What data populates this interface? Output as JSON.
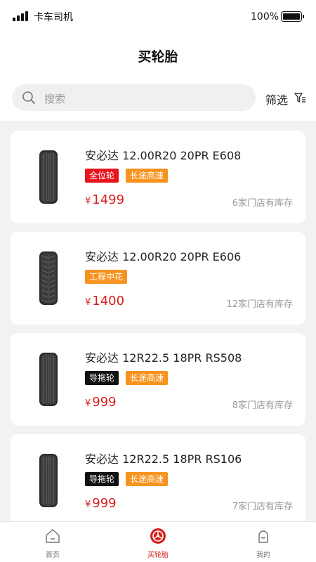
{
  "status_bar": {
    "carrier": "卡车司机",
    "battery_percent": "100%",
    "battery_level": 1.0
  },
  "header": {
    "title": "买轮胎"
  },
  "search": {
    "placeholder": "搜索",
    "icon": "search-icon"
  },
  "filter": {
    "label": "筛选",
    "icon": "filter-icon"
  },
  "products": [
    {
      "title": "安必达 12.00R20 20PR E608",
      "tags": [
        {
          "label": "全位轮",
          "color": "#e8141c"
        },
        {
          "label": "长途高速",
          "color": "#f7931e"
        }
      ],
      "currency": "¥",
      "price": "1499",
      "stock": "6家门店有库存",
      "tread": "rib"
    },
    {
      "title": "安必达 12.00R20 20PR E606",
      "tags": [
        {
          "label": "工程中花",
          "color": "#f7931e"
        }
      ],
      "currency": "¥",
      "price": "1400",
      "stock": "12家门店有库存",
      "tread": "block"
    },
    {
      "title": "安必达 12R22.5 18PR RS508",
      "tags": [
        {
          "label": "导拖轮",
          "color": "#111111"
        },
        {
          "label": "长途高速",
          "color": "#f7931e"
        }
      ],
      "currency": "¥",
      "price": "999",
      "stock": "8家门店有库存",
      "tread": "rib"
    },
    {
      "title": "安必达 12R22.5 18PR RS106",
      "tags": [
        {
          "label": "导拖轮",
          "color": "#111111"
        },
        {
          "label": "长途高速",
          "color": "#f7931e"
        }
      ],
      "currency": "¥",
      "price": "999",
      "stock": "7家门店有库存",
      "tread": "rib"
    }
  ],
  "tabbar": {
    "tabs": [
      {
        "label": "首页",
        "icon": "home-icon",
        "active": false
      },
      {
        "label": "买轮胎",
        "icon": "tire-icon",
        "active": true
      },
      {
        "label": "我的",
        "icon": "profile-icon",
        "active": false
      }
    ]
  },
  "colors": {
    "accent": "#d81e1e",
    "orange_tag": "#f7931e",
    "red_tag": "#e8141c",
    "black_tag": "#111111",
    "page_bg": "#f2f2f2"
  }
}
